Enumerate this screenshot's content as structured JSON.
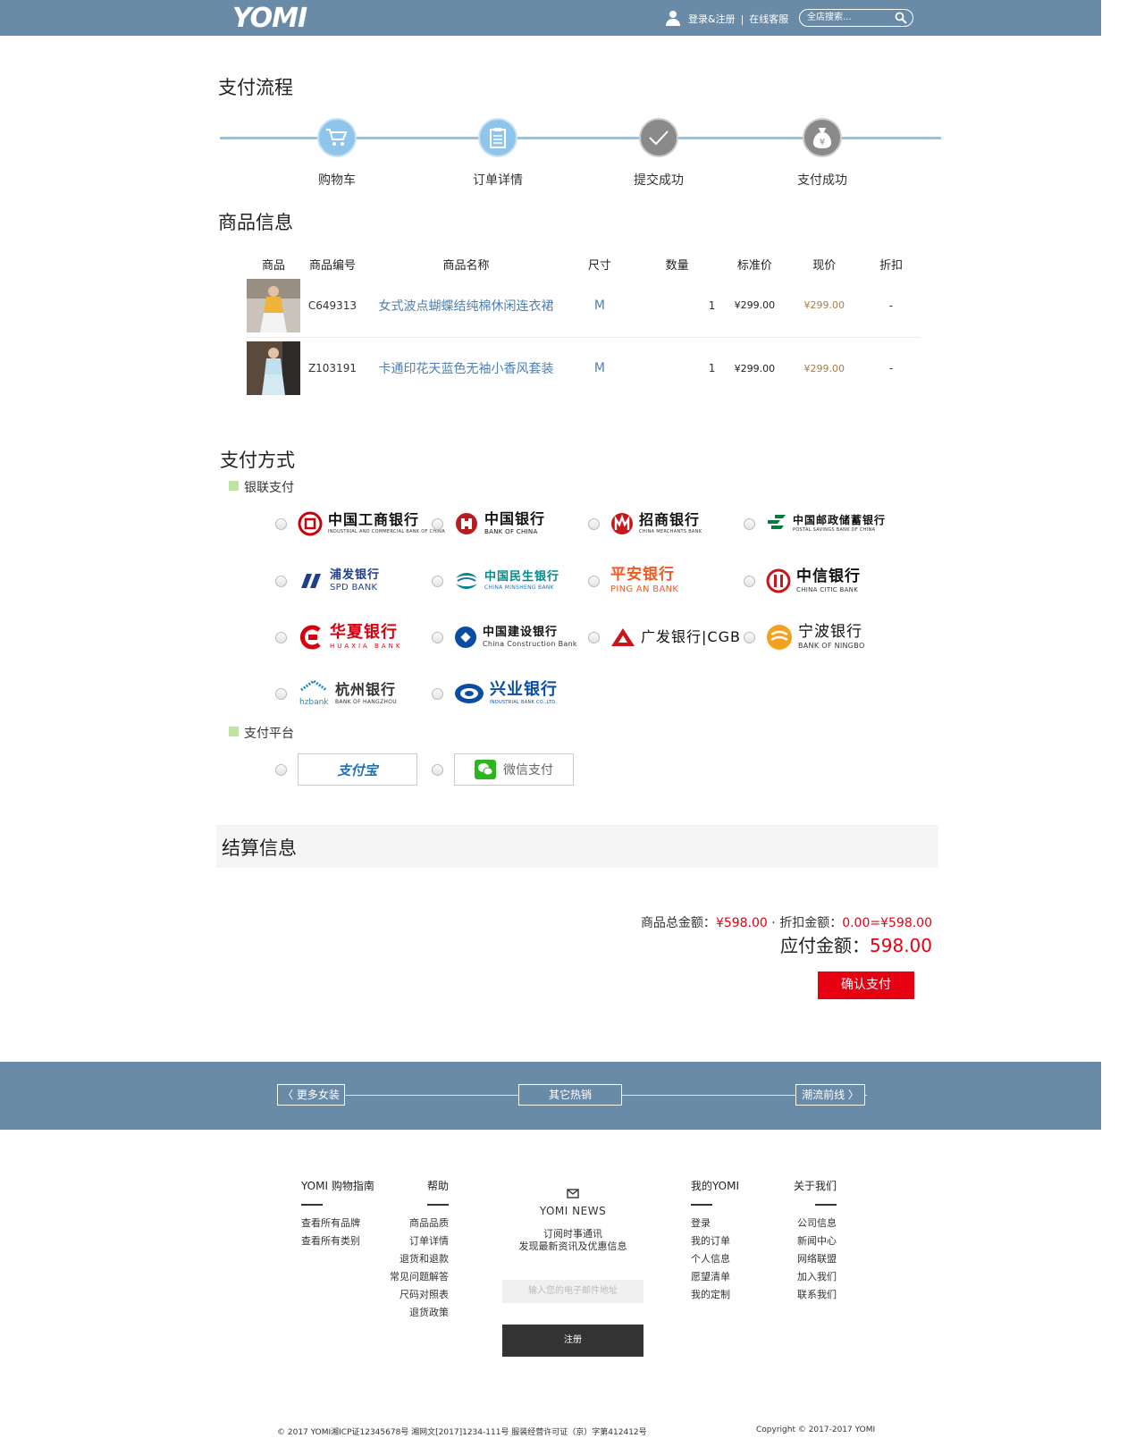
{
  "header": {
    "logo": "YOMI",
    "login_label": "登录&注册",
    "separator": "|",
    "service_label": "在线客服",
    "search_placeholder": "全店搜索..."
  },
  "flow": {
    "title": "支付流程",
    "steps": [
      {
        "label": "购物车"
      },
      {
        "label": "订单详情"
      },
      {
        "label": "提交成功"
      },
      {
        "label": "支付成功"
      }
    ]
  },
  "goods": {
    "title": "商品信息",
    "headers": [
      "商品",
      "商品编号",
      "商品名称",
      "尺寸",
      "数量",
      "标准价",
      "现价",
      "折扣"
    ],
    "rows": [
      {
        "sku": "C649313",
        "name": "女式波点蝴蝶结纯棉休闲连衣裙",
        "size": "M",
        "qty": "1",
        "std": "¥299.00",
        "now": "¥299.00",
        "discount": "-"
      },
      {
        "sku": "Z103191",
        "name": "卡通印花天蓝色无袖小香风套装",
        "size": "M",
        "qty": "1",
        "std": "¥299.00",
        "now": "¥299.00",
        "discount": "-"
      }
    ]
  },
  "payment": {
    "title": "支付方式",
    "unionpay_label": "银联支付",
    "banks": [
      {
        "cn": "中国工商银行",
        "en": "INDUSTRIAL AND COMMERCIAL BANK OF CHINA",
        "color": "#c7000b"
      },
      {
        "cn": "中国银行",
        "en": "BANK OF CHINA",
        "color": "#b81c22"
      },
      {
        "cn": "招商银行",
        "en": "CHINA MERCHANTS BANK",
        "color": "#c8161d"
      },
      {
        "cn": "中国邮政储蓄银行",
        "en": "POSTAL SAVINGS BANK OF CHINA",
        "color": "#007c3d"
      },
      {
        "cn": "浦发银行",
        "en": "SPD BANK",
        "color": "#1e3f8b"
      },
      {
        "cn": "中国民生银行",
        "en": "CHINA MINSHENG BANK",
        "color": "#008a8a"
      },
      {
        "cn": "平安银行",
        "en": "PING AN BANK",
        "color": "#f05a22"
      },
      {
        "cn": "中信银行",
        "en": "CHINA CITIC BANK",
        "color": "#c8161d"
      },
      {
        "cn": "华夏银行",
        "en": "HUAXIA BANK",
        "color": "#d7000f"
      },
      {
        "cn": "中国建设银行",
        "en": "China Construction Bank",
        "color": "#0a4da2"
      },
      {
        "cn": "广发银行|CGB",
        "en": "",
        "color": "#c8161d"
      },
      {
        "cn": "宁波银行",
        "en": "BANK OF NINGBO",
        "color": "#f4a21b"
      },
      {
        "cn": "杭州银行",
        "en": "BANK OF HANGZHOU",
        "color": "#1f88c9"
      },
      {
        "cn": "兴业银行",
        "en": "INDUSTRIAL BANK CO.,LTD.",
        "color": "#0a4da2"
      }
    ],
    "platform_label": "支付平台",
    "platforms": [
      {
        "name": "支付宝",
        "color": "#1e73be"
      },
      {
        "name": "微信支付",
        "color": "#2db51f"
      }
    ]
  },
  "settlement": {
    "title": "结算信息",
    "total_label": "商品总金额：",
    "total_value": "¥598.00",
    "discount_label": "· 折扣金额：",
    "discount_value": "0.00=¥598.00",
    "due_label": "应付金额：",
    "due_value": "598.00",
    "confirm_label": "确认支付"
  },
  "band": {
    "left": "〈  更多女装",
    "center": "其它热销",
    "right": "潮流前线  〉"
  },
  "footer": {
    "guide": {
      "title": "YOMI 购物指南",
      "items": [
        "查看所有品牌",
        "查看所有类别"
      ]
    },
    "help": {
      "title": "帮助",
      "items": [
        "商品品质",
        "订单详情",
        "退货和退款",
        "常见问题解答",
        "尺码对照表",
        "退货政策"
      ]
    },
    "news": {
      "title": "YOMI NEWS",
      "line1": "订阅时事通讯",
      "line2": "发现最新资讯及优惠信息",
      "email_placeholder": "输入您的电子邮件地址",
      "register_label": "注册"
    },
    "my": {
      "title": "我的YOMI",
      "items": [
        "登录",
        "我的订单",
        "个人信息",
        "愿望清单",
        "我的定制"
      ]
    },
    "about": {
      "title": "关于我们",
      "items": [
        "公司信息",
        "新闻中心",
        "网络联盟",
        "加入我们",
        "联系我们"
      ]
    },
    "copyright_left": "© 2017 YOMI湘ICP证12345678号 湘网文[2017]1234-111号  服装经营许可证（京）字第412412号",
    "copyright_right": "Copyright © 2017-2017 YOMI"
  }
}
